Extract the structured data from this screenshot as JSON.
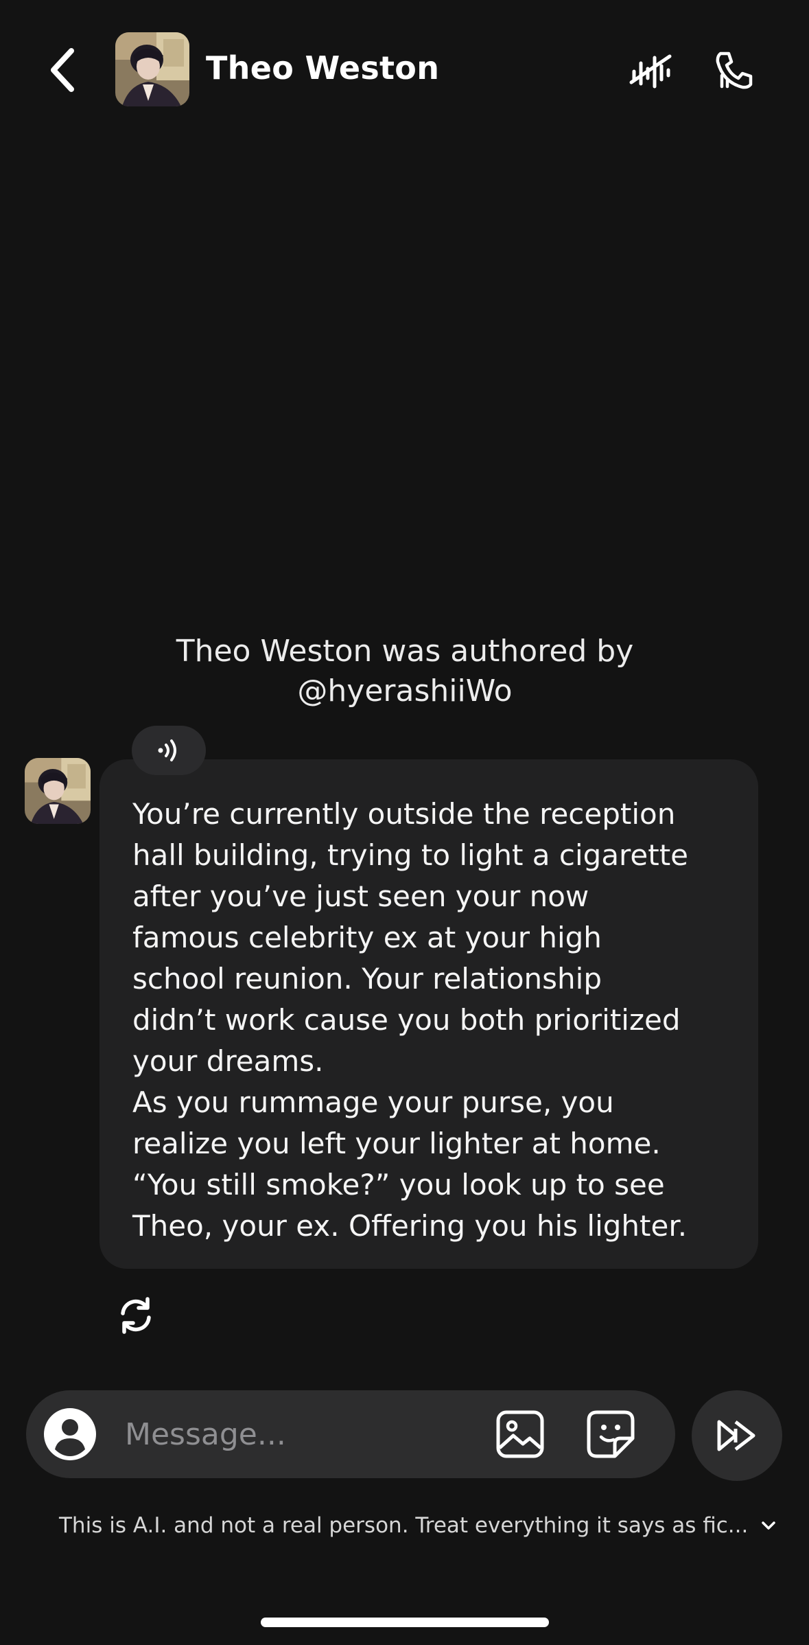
{
  "header": {
    "title": "Theo Weston",
    "back_icon": "chevron-left-icon",
    "avatar": "character-avatar",
    "voice_icon": "voice-off-icon",
    "call_icon": "phone-call-icon"
  },
  "author_credit": {
    "line1": "Theo Weston was authored by",
    "line2": "@hyerashiiWo"
  },
  "message": {
    "sender": "Theo Weston",
    "audio_icon": "speaker-wave-icon",
    "text": "You’re currently outside the reception\nhall building, trying to light a cigarette\nafter you’ve just seen your now\nfamous celebrity ex at your high\nschool reunion. Your relationship\ndidn’t work cause you both prioritized\nyour dreams.\nAs you rummage your purse, you\nrealize you left your lighter at home.\n“You still smoke?” you look up to see\nTheo, your ex. Offering you his lighter.",
    "regenerate_icon": "refresh-icon"
  },
  "composer": {
    "placeholder": "Message...",
    "value": "",
    "profile_icon": "user-circle-icon",
    "image_icon": "image-icon",
    "sticker_icon": "sticker-icon",
    "send_icon": "fast-forward-icon"
  },
  "disclaimer": {
    "text": "This is A.I. and not a real person. Treat everything it says as fic...",
    "chevron_icon": "chevron-down-icon"
  },
  "colors": {
    "background": "#131313",
    "bubble": "#212122",
    "composer": "#2d2d2e",
    "placeholder": "#8f8f92"
  }
}
